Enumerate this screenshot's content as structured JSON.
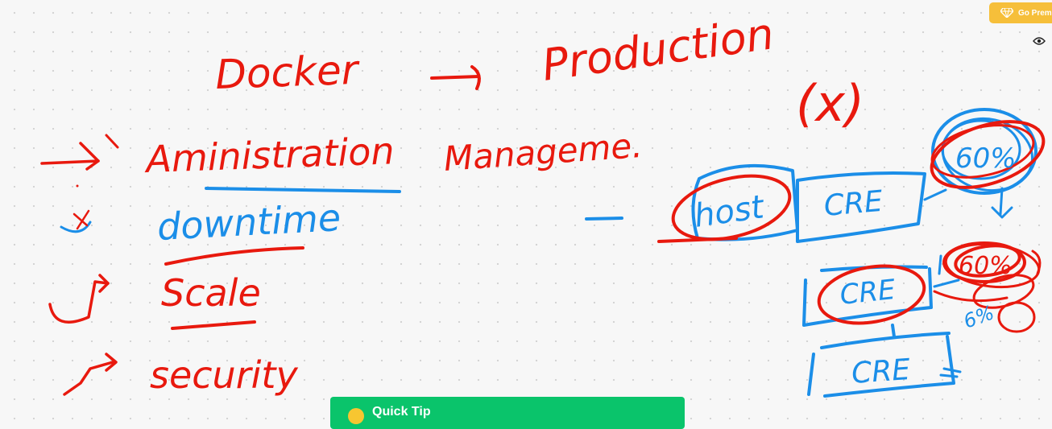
{
  "whiteboard": {
    "title_docker": "Docker",
    "title_production": "Production",
    "x_mark": "(x)",
    "items": [
      {
        "label": "Aministration",
        "marker": "red"
      },
      {
        "label": "downtime",
        "marker": "blue"
      },
      {
        "label": "Scale",
        "marker": "red"
      },
      {
        "label": "security",
        "marker": "red"
      }
    ],
    "management": "Manageme.",
    "host": "host",
    "cre_top": "CRE",
    "cre_mid": "CRE",
    "cre_bottom": "CRE",
    "note_top_right": "60%",
    "note_mid_right": "60%",
    "note_small": "6%"
  },
  "toolbar": {
    "premium_label": "Go Premium",
    "premium_icon": "diamond-icon",
    "view_icon": "eye-icon"
  },
  "toast": {
    "label": "Quick Tip",
    "icon": "emoji-icon",
    "color": "#0ac46b"
  },
  "colors": {
    "red_ink": "#e8190e",
    "blue_ink": "#1b8ee8",
    "premium": "#f6bf3a"
  }
}
